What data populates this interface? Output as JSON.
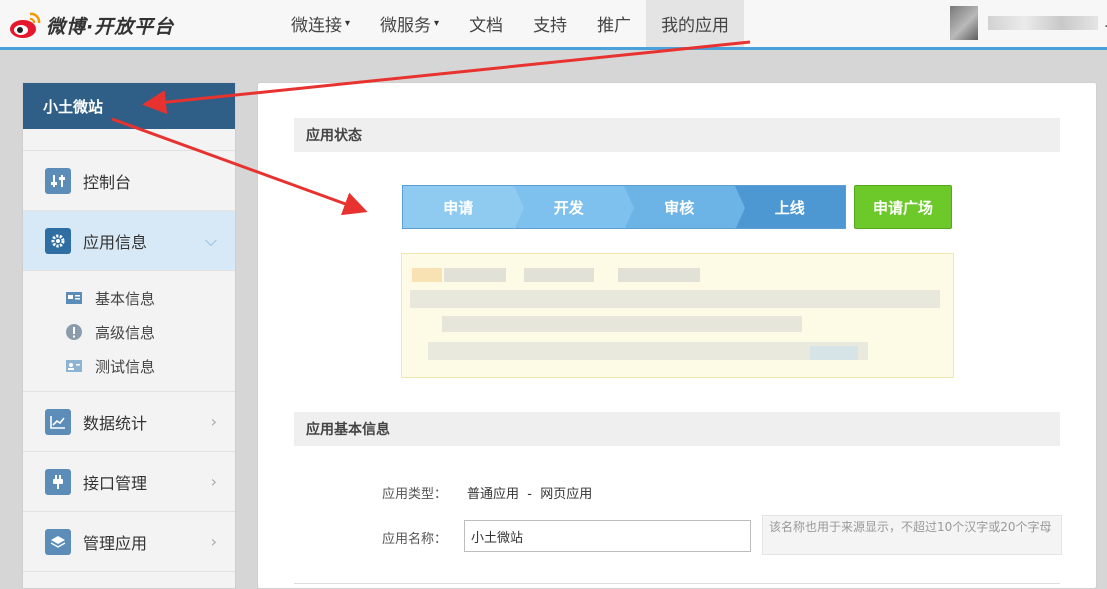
{
  "brand": {
    "name": "微博·开放平台"
  },
  "nav": {
    "items": [
      {
        "label": "微连接",
        "caret": "▾"
      },
      {
        "label": "微服务",
        "caret": "▾"
      },
      {
        "label": "文档"
      },
      {
        "label": "支持"
      },
      {
        "label": "推广"
      },
      {
        "label": "我的应用"
      }
    ],
    "user_caret": "."
  },
  "sidebar": {
    "app_name": "小土微站",
    "items": [
      {
        "label": "控制台",
        "icon": "sliders-icon"
      },
      {
        "label": "应用信息",
        "icon": "gear-icon",
        "arrow": "⌵"
      },
      {
        "label": "数据统计",
        "icon": "chart-icon",
        "arrow": "›"
      },
      {
        "label": "接口管理",
        "icon": "plug-icon",
        "arrow": "›"
      },
      {
        "label": "管理应用",
        "icon": "layers-icon",
        "arrow": "›"
      }
    ],
    "sub_items": [
      {
        "label": "基本信息",
        "icon": "card-icon"
      },
      {
        "label": "高级信息",
        "icon": "info-icon"
      },
      {
        "label": "测试信息",
        "icon": "id-icon"
      }
    ]
  },
  "main": {
    "status_title": "应用状态",
    "steps": [
      "申请",
      "开发",
      "审核",
      "上线"
    ],
    "plaza_button": "申请广场",
    "basic_title": "应用基本信息",
    "type_label": "应用类型：",
    "type_value": "普通应用  -  网页应用",
    "name_label": "应用名称：",
    "name_value": "小土微站",
    "name_hint": "该名称也用于来源显示，不超过10个汉字或20个字母"
  },
  "colors": {
    "accent": "#4aa0d8",
    "sidebar_head": "#2f5f86",
    "plaza_green": "#6dc92a",
    "annotation_red": "#e8322f"
  }
}
